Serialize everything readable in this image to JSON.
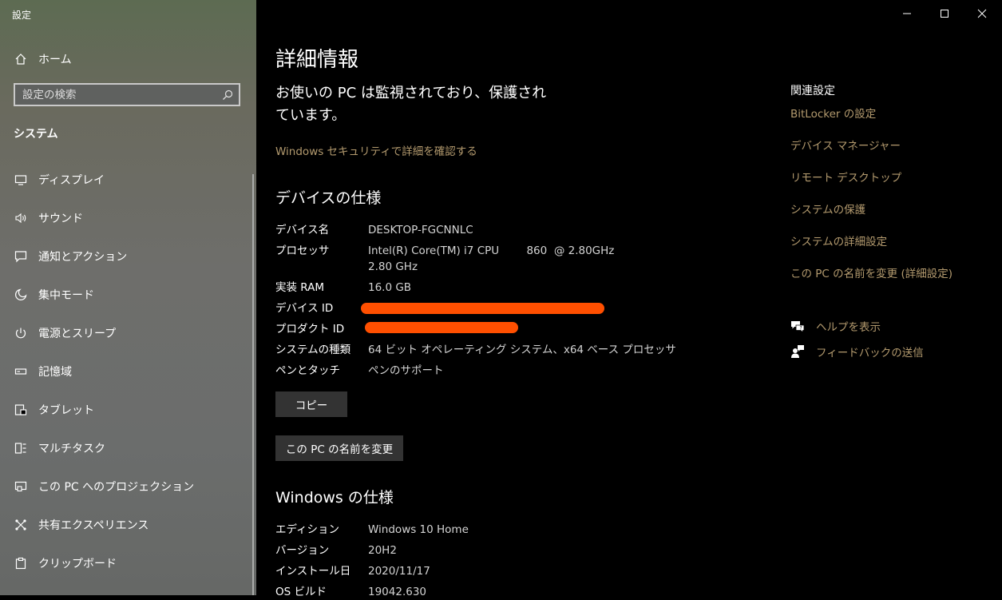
{
  "window": {
    "title": "設定"
  },
  "sidebar": {
    "home_label": "ホーム",
    "search_placeholder": "設定の検索",
    "section_title": "システム",
    "items": [
      {
        "label": "ディスプレイ",
        "icon": "display-icon"
      },
      {
        "label": "サウンド",
        "icon": "sound-icon"
      },
      {
        "label": "通知とアクション",
        "icon": "notification-icon"
      },
      {
        "label": "集中モード",
        "icon": "moon-icon"
      },
      {
        "label": "電源とスリープ",
        "icon": "power-icon"
      },
      {
        "label": "記憶域",
        "icon": "storage-icon"
      },
      {
        "label": "タブレット",
        "icon": "tablet-icon"
      },
      {
        "label": "マルチタスク",
        "icon": "multitask-icon"
      },
      {
        "label": "この PC へのプロジェクション",
        "icon": "projection-icon"
      },
      {
        "label": "共有エクスペリエンス",
        "icon": "shared-icon"
      },
      {
        "label": "クリップボード",
        "icon": "clipboard-icon"
      }
    ]
  },
  "main": {
    "page_title": "詳細情報",
    "status_text": "お使いの PC は監視されており、保護されています。",
    "security_link": "Windows セキュリティで詳細を確認する",
    "device_specs": {
      "heading": "デバイスの仕様",
      "rows": [
        {
          "label": "デバイス名",
          "value": "DESKTOP-FGCNNLC"
        },
        {
          "label": "プロセッサ",
          "value": "Intel(R) Core(TM) i7 CPU        860  @ 2.80GHz\n2.80 GHz"
        },
        {
          "label": "実装 RAM",
          "value": "16.0 GB"
        },
        {
          "label": "デバイス ID",
          "value": ""
        },
        {
          "label": "プロダクト ID",
          "value": ""
        },
        {
          "label": "システムの種類",
          "value": "64 ビット オペレーティング システム、x64 ベース プロセッサ"
        },
        {
          "label": "ペンとタッチ",
          "value": "ペンのサポート"
        }
      ],
      "copy_button": "コピー",
      "rename_button": "この PC の名前を変更"
    },
    "windows_specs": {
      "heading": "Windows の仕様",
      "rows": [
        {
          "label": "エディション",
          "value": "Windows 10 Home"
        },
        {
          "label": "バージョン",
          "value": "20H2"
        },
        {
          "label": "インストール日",
          "value": "2020/11/17"
        },
        {
          "label": "OS ビルド",
          "value": "19042.630"
        }
      ]
    }
  },
  "related": {
    "heading": "関連設定",
    "links": [
      "BitLocker の設定",
      "デバイス マネージャー",
      "リモート デスクトップ",
      "システムの保護",
      "システムの詳細設定",
      "この PC の名前を変更 (詳細設定)"
    ],
    "help_label": "ヘルプを表示",
    "feedback_label": "フィードバックの送信"
  },
  "colors": {
    "accent_link": "#b39a6e",
    "redaction": "#ff4f00",
    "button_bg": "#333333"
  }
}
